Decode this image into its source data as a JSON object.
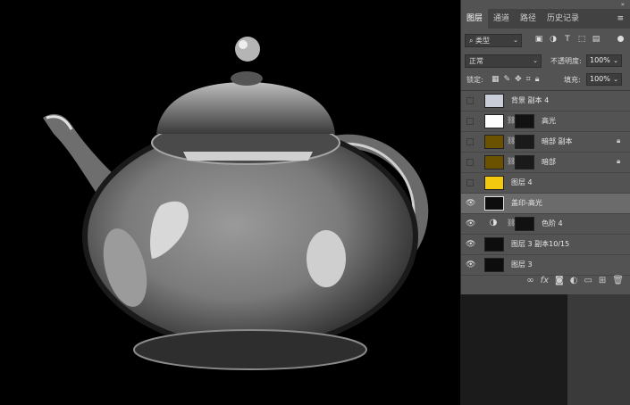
{
  "panel": {
    "tabs": [
      {
        "label": "图层",
        "active": true
      },
      {
        "label": "通道",
        "active": false
      },
      {
        "label": "路径",
        "active": false
      },
      {
        "label": "历史记录",
        "active": false
      }
    ],
    "menu_icon": "≡",
    "collapse_icon": "»",
    "filter": {
      "value": "类型",
      "icon": "search-icon"
    },
    "filter_icons": [
      "image-filter-icon",
      "adjustment-filter-icon",
      "type-filter-icon",
      "shape-filter-icon",
      "smart-object-filter-icon"
    ],
    "blend_mode": "正常",
    "opacity_label": "不透明度:",
    "opacity_value": "100%",
    "lock_label": "锁定:",
    "fill_label": "填充:",
    "fill_value": "100%",
    "lock_icons": [
      "lock-transparent-icon",
      "lock-pixels-icon",
      "lock-position-icon",
      "lock-artboard-icon",
      "lock-all-icon"
    ],
    "layers": [
      {
        "name": "背景 副本 4",
        "visible": false,
        "thumb": "teapot-light",
        "mask": null,
        "locked": false,
        "selected": false,
        "adjustment": false
      },
      {
        "name": "高光",
        "visible": false,
        "thumb": "white",
        "mask": "teapot-mask",
        "locked": false,
        "selected": false,
        "adjustment": false
      },
      {
        "name": "暗部 副本",
        "visible": false,
        "thumb": "olive",
        "mask": "teapot-outline",
        "locked": true,
        "selected": false,
        "adjustment": false
      },
      {
        "name": "暗部",
        "visible": false,
        "thumb": "olive",
        "mask": "teapot-outline",
        "locked": true,
        "selected": false,
        "adjustment": false
      },
      {
        "name": "图层 4",
        "visible": false,
        "thumb": "yellow",
        "mask": null,
        "locked": false,
        "selected": false,
        "adjustment": false
      },
      {
        "name": "盖印-高光",
        "visible": true,
        "thumb": "teapot-dark",
        "mask": null,
        "locked": false,
        "selected": true,
        "adjustment": false
      },
      {
        "name": "色阶 4",
        "visible": true,
        "thumb": null,
        "mask": "teapot-mask",
        "locked": false,
        "selected": false,
        "adjustment": true
      },
      {
        "name": "图层 3 副本10/15",
        "visible": true,
        "thumb": "teapot-dark",
        "mask": null,
        "locked": false,
        "selected": false,
        "adjustment": false
      },
      {
        "name": "图层 3",
        "visible": true,
        "thumb": "teapot-dark",
        "mask": null,
        "locked": false,
        "selected": false,
        "adjustment": false
      }
    ],
    "bottom_icons": [
      "link-icon",
      "fx-icon",
      "mask-icon",
      "adjustment-icon",
      "group-folder-icon",
      "new-layer-icon",
      "trash-icon"
    ],
    "colors": {
      "yellow": "#f3c90f",
      "olive": "#6b5200",
      "panel": "#535353",
      "selected": "#6b6b6b"
    }
  }
}
